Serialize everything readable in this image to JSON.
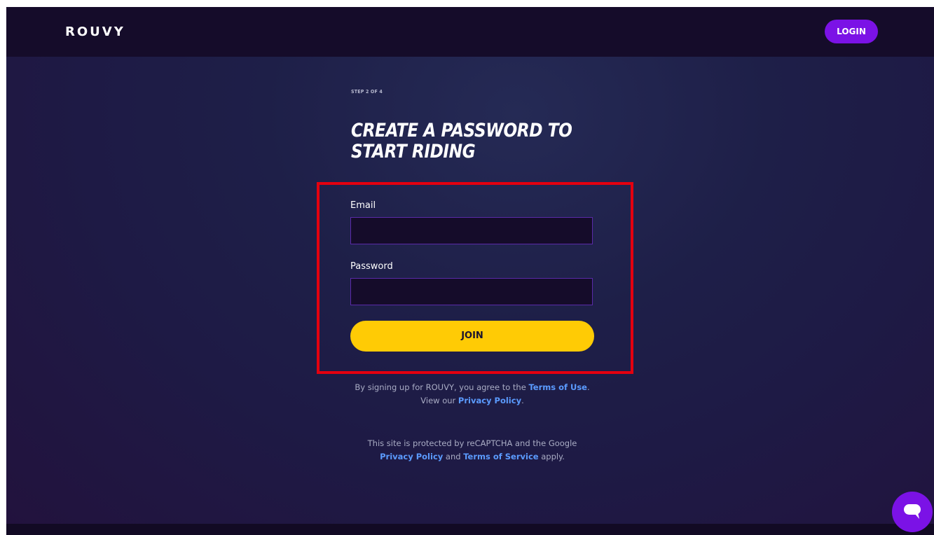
{
  "header": {
    "logo_text": "ROUVY",
    "login_label": "LOGIN"
  },
  "main": {
    "step_text": "STEP 2 OF 4",
    "heading_line1": "CREATE A PASSWORD TO",
    "heading_line2": "START RIDING"
  },
  "form": {
    "email_label": "Email",
    "email_value": "",
    "password_label": "Password",
    "password_value": "",
    "join_label": "JOIN"
  },
  "legal": {
    "terms_prefix": "By signing up for ROUVY, you agree to the ",
    "terms_link": "Terms of Use",
    "terms_middle": ". View our ",
    "privacy_link": "Privacy Policy",
    "terms_suffix": ".",
    "recaptcha_prefix": "This site is protected by reCAPTCHA and the Google ",
    "google_privacy_link": "Privacy Policy",
    "recaptcha_and": " and ",
    "google_terms_link": "Terms of Service",
    "recaptcha_suffix": " apply."
  },
  "chat": {
    "icon": "chat-bubble-icon"
  },
  "colors": {
    "accent_purple": "#7b12e6",
    "join_yellow": "#ffcb05",
    "link_blue": "#5b9bff",
    "highlight_red": "#e4000f"
  }
}
